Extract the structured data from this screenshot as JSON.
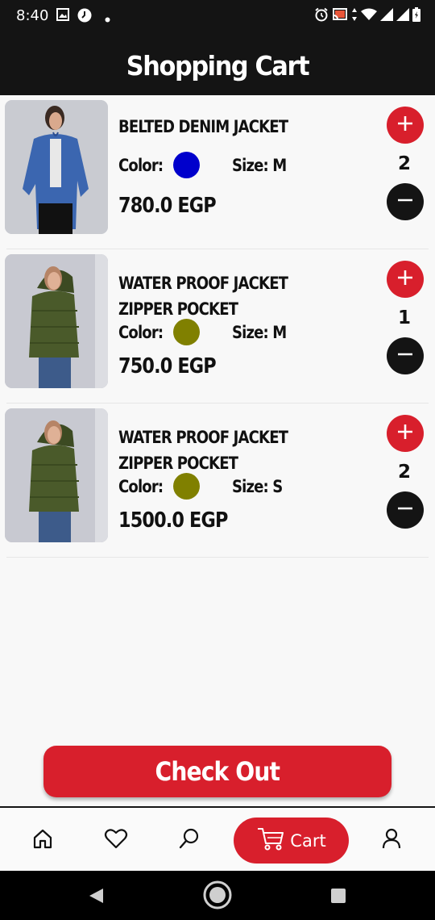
{
  "status_bar": {
    "time": "8:40",
    "left_icons": [
      "image-icon",
      "clock-icon",
      "dot-icon"
    ],
    "right_icons": [
      "alarm-icon",
      "cast-icon",
      "data-arrows-icon",
      "wifi-icon",
      "signal-icon",
      "signal-icon",
      "battery-icon"
    ]
  },
  "header": {
    "title": "Shopping Cart"
  },
  "cart": {
    "items": [
      {
        "name": "BELTED DENIM JACKET",
        "color_label": "Color:",
        "color": "#0000cc",
        "size_label": "Size: M",
        "price": "780.0 EGP",
        "quantity": "2",
        "image": "denim-jacket-photo"
      },
      {
        "name": "WATER PROOF JACKET ZIPPER POCKET",
        "color_label": "Color:",
        "color": "#808000",
        "size_label": "Size: M",
        "price": "750.0 EGP",
        "quantity": "1",
        "image": "olive-jacket-photo"
      },
      {
        "name": "WATER PROOF JACKET ZIPPER POCKET",
        "color_label": "Color:",
        "color": "#808000",
        "size_label": "Size: S",
        "price": "1500.0 EGP",
        "quantity": "2",
        "image": "olive-jacket-photo"
      }
    ]
  },
  "checkout": {
    "label": "Check Out"
  },
  "bottom_nav": {
    "items": [
      {
        "icon": "home-icon"
      },
      {
        "icon": "heart-icon"
      },
      {
        "icon": "search-icon"
      },
      {
        "icon": "cart-icon",
        "label": "Cart",
        "active": true
      },
      {
        "icon": "person-icon"
      }
    ]
  },
  "colors": {
    "accent": "#d81f2c",
    "dark": "#141414",
    "background": "#f8f8f8"
  }
}
